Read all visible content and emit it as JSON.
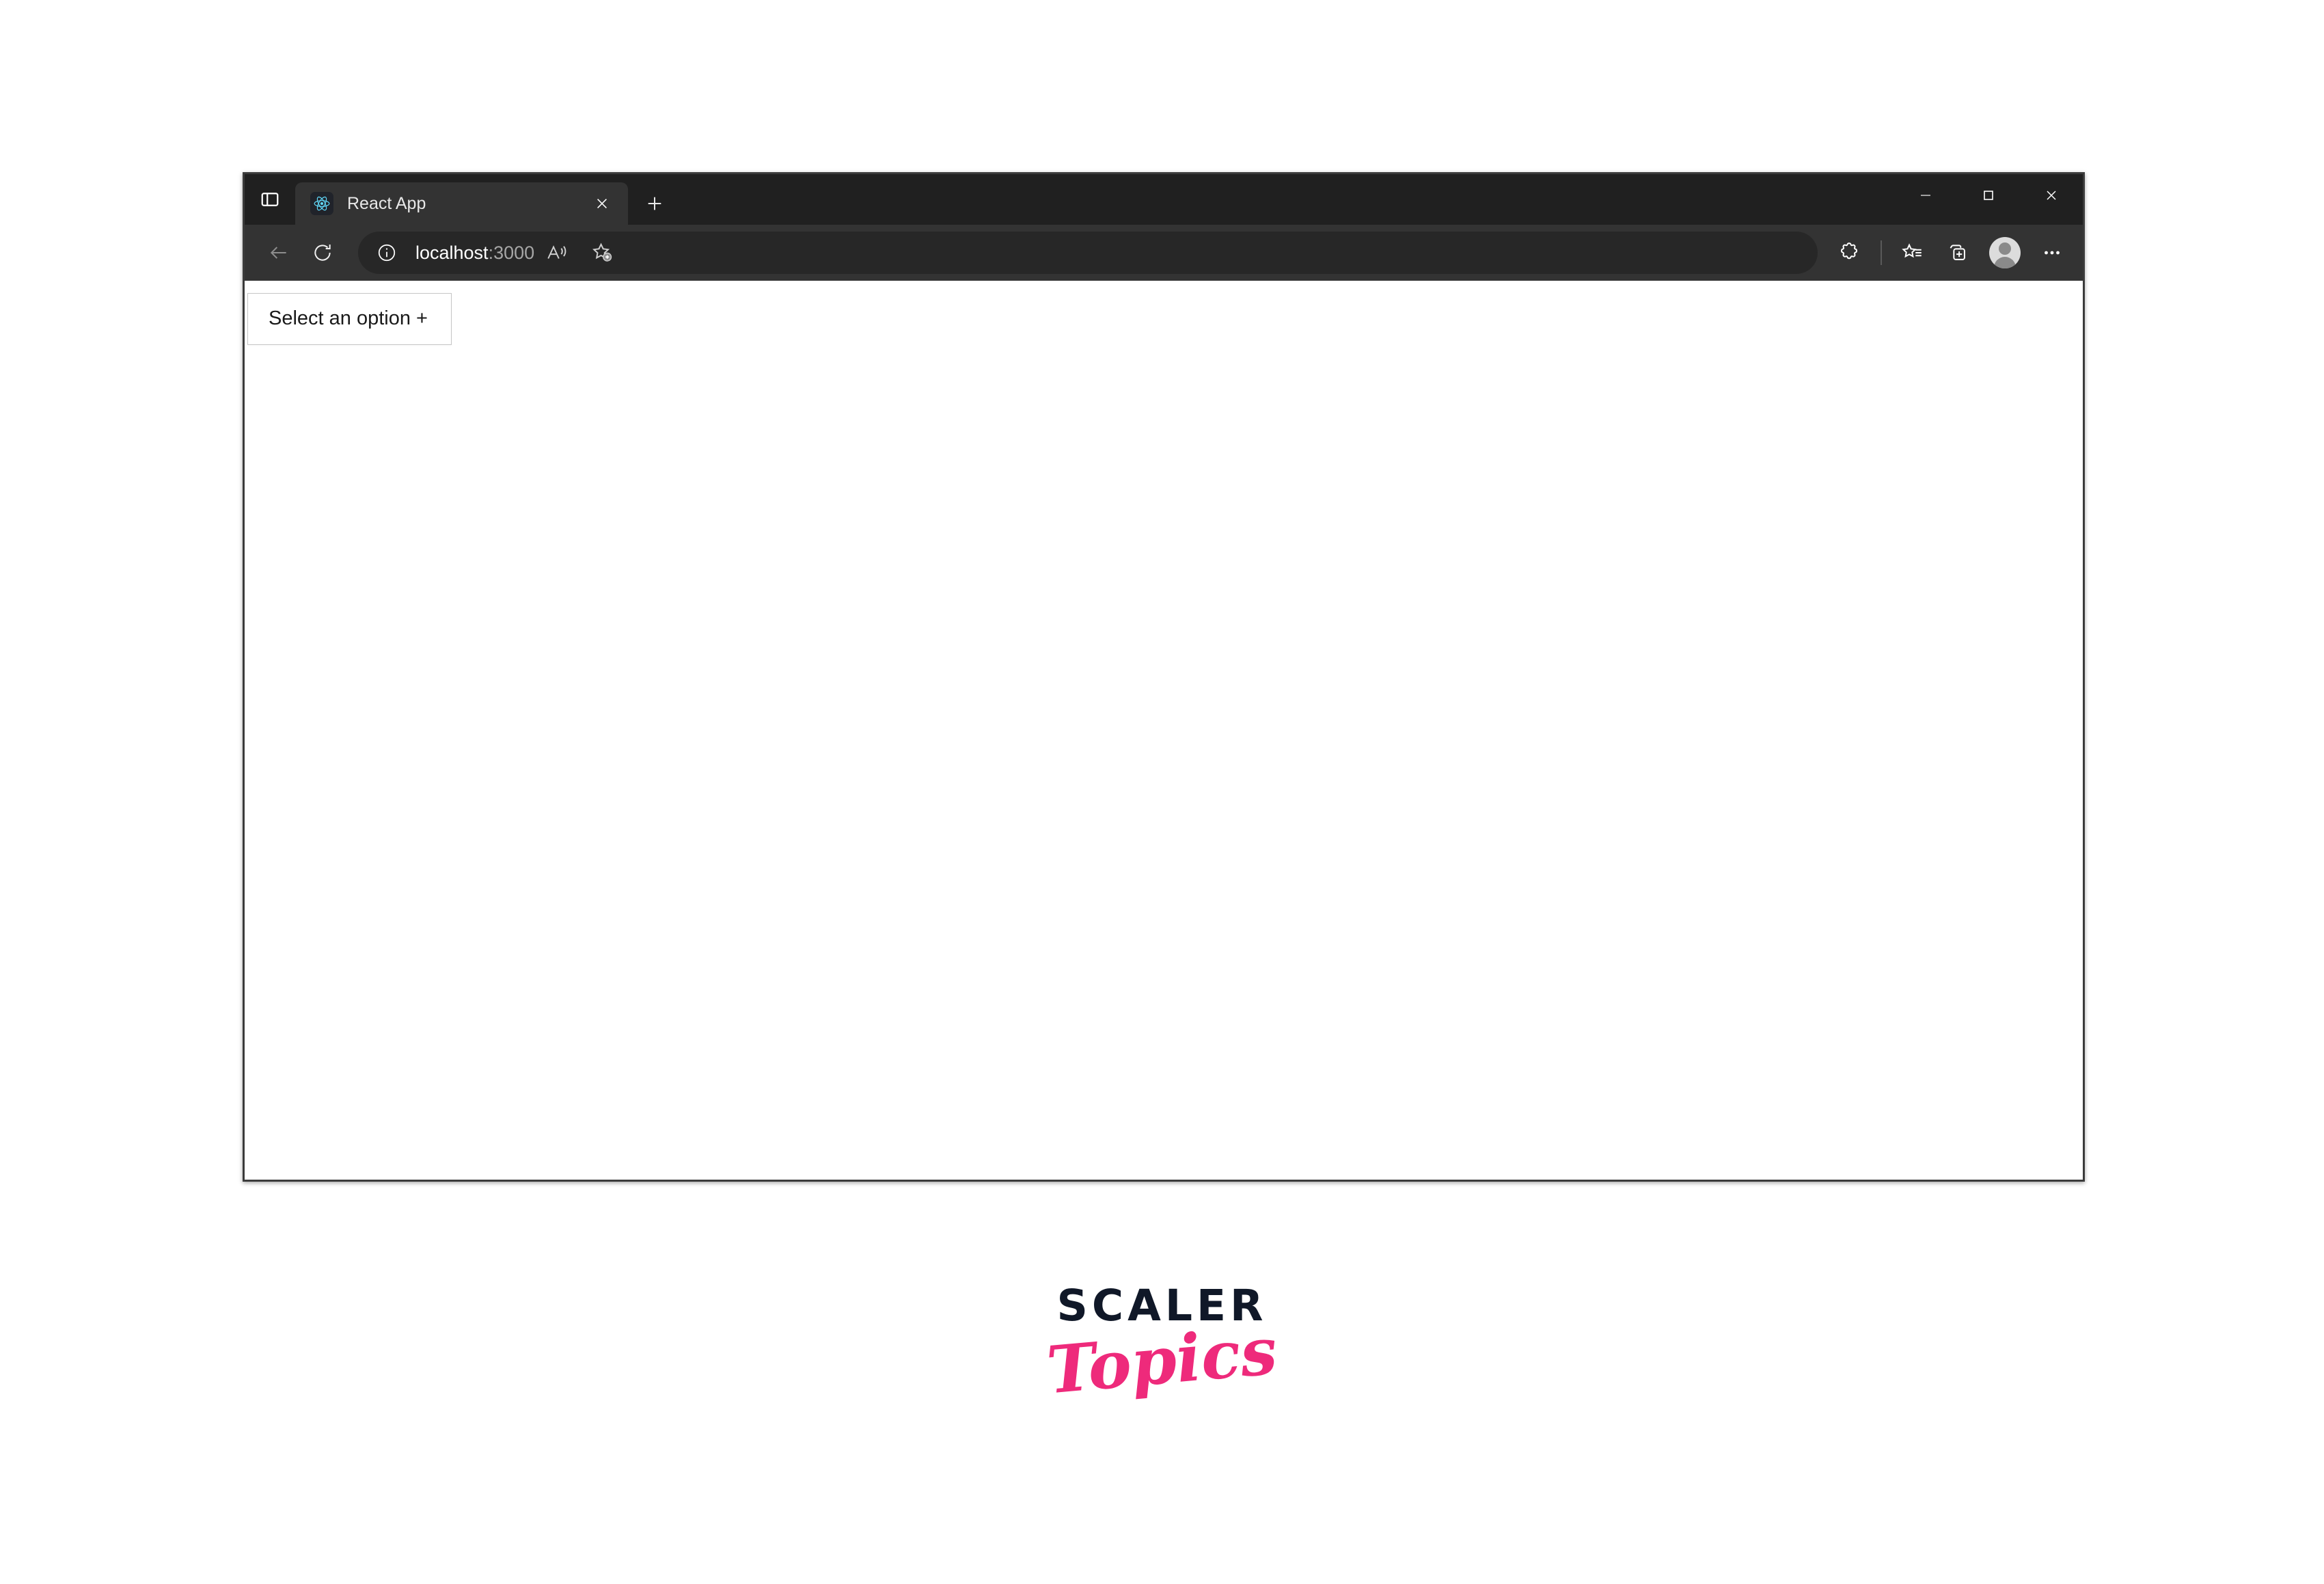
{
  "window": {
    "controls": {
      "minimize_label": "Minimize",
      "maximize_label": "Maximize",
      "close_label": "Close"
    }
  },
  "titlebar": {
    "tab_list_label": "Tab actions menu",
    "tabs": [
      {
        "title": "React App",
        "favicon": "react-icon",
        "close_label": "Close tab",
        "active": true
      }
    ],
    "new_tab_label": "New tab"
  },
  "toolbar": {
    "back_label": "Back",
    "refresh_label": "Refresh",
    "info_icon": "site-information-icon",
    "url_host": "localhost",
    "url_port": ":3000",
    "actions": [
      {
        "name": "read-aloud-icon",
        "label": "Read aloud"
      },
      {
        "name": "add-favorite-icon",
        "label": "Add this page to favorites"
      },
      {
        "name": "extensions-icon",
        "label": "Extensions"
      },
      {
        "name": "favorites-icon",
        "label": "Favorites"
      },
      {
        "name": "collections-icon",
        "label": "Collections"
      },
      {
        "name": "profile-avatar",
        "label": "Profile"
      },
      {
        "name": "settings-more-icon",
        "label": "Settings and more"
      }
    ]
  },
  "page": {
    "dropdown": {
      "label": "Select an option +",
      "options": []
    }
  },
  "branding": {
    "logo_primary": "SCALER",
    "logo_secondary": "Topics",
    "primary_color": "#101828",
    "secondary_color": "#ee2a7b"
  }
}
